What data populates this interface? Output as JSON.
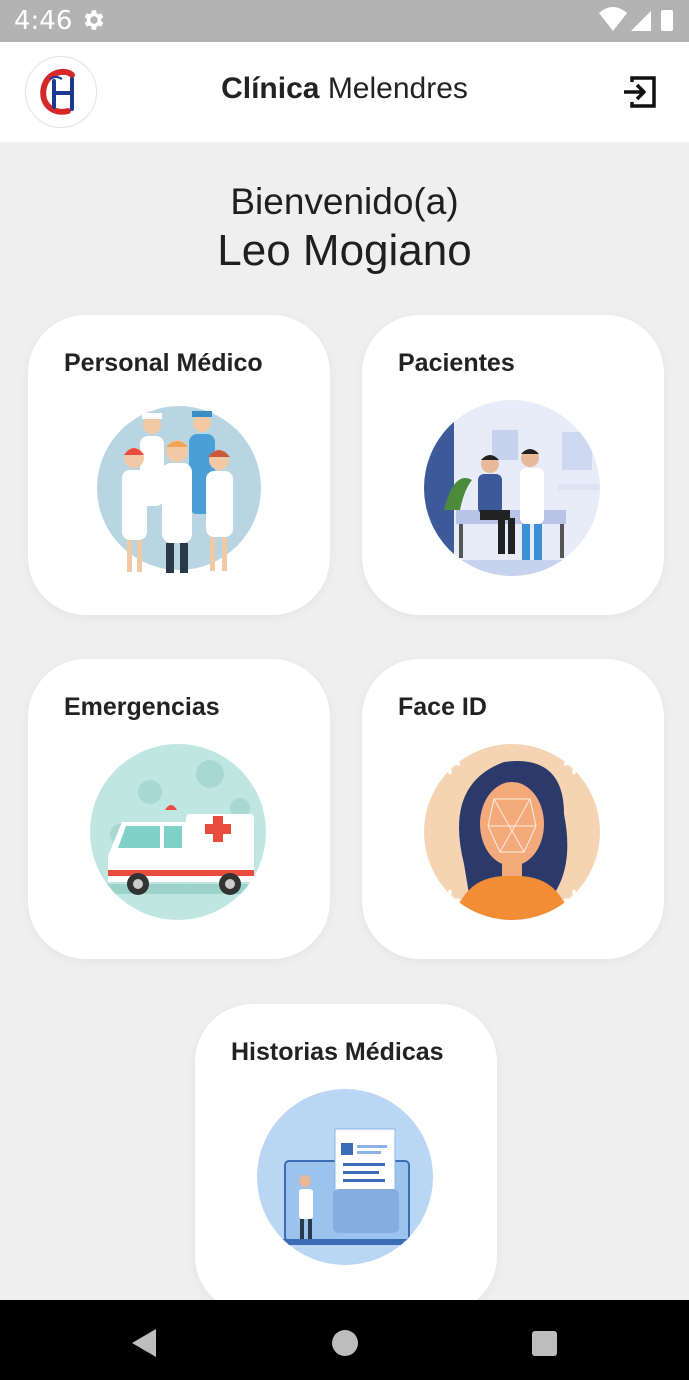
{
  "status_bar": {
    "time": "4:46",
    "settings_icon": "gear-icon",
    "wifi_icon": "wifi-icon",
    "signal_icon": "signal-icon",
    "battery_icon": "battery-icon"
  },
  "app_bar": {
    "logo_icon": "clinic-logo",
    "title_bold": "Clínica",
    "title_regular": "Melendres",
    "logout_icon": "logout-icon"
  },
  "welcome": {
    "greeting": "Bienvenido(a)",
    "user_name": "Leo Mogiano"
  },
  "menu": [
    {
      "title": "Personal Médico",
      "illustration": "medical-staff-illustration"
    },
    {
      "title": "Pacientes",
      "illustration": "patient-illustration"
    },
    {
      "title": "Emergencias",
      "illustration": "ambulance-illustration"
    },
    {
      "title": "Face ID",
      "illustration": "face-id-illustration"
    },
    {
      "title": "Historias Médicas",
      "illustration": "medical-records-illustration"
    }
  ],
  "nav_bar": {
    "back_icon": "back-icon",
    "home_icon": "home-icon",
    "recents_icon": "recents-icon"
  },
  "colors": {
    "status_bar": "#b3b3b3",
    "background": "#efefef",
    "card": "#ffffff",
    "logo_red": "#d62828",
    "logo_blue": "#1b3a8f"
  }
}
